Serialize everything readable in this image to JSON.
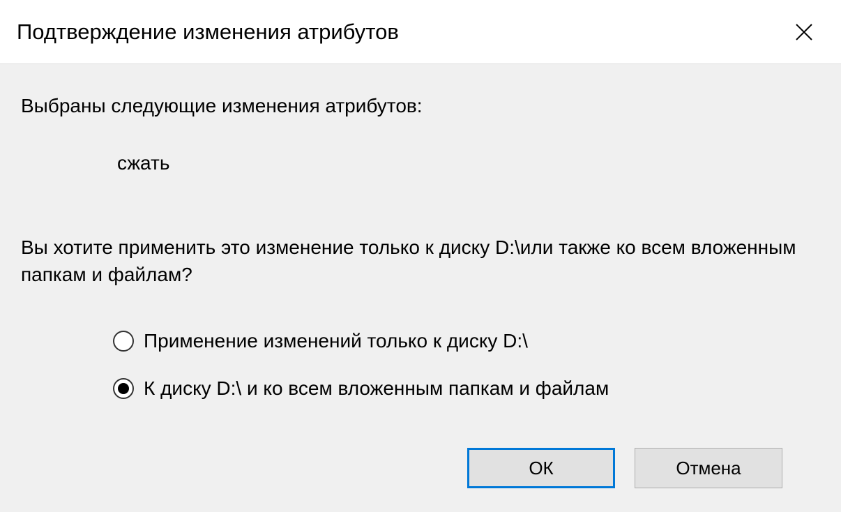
{
  "titlebar": {
    "title": "Подтверждение изменения атрибутов"
  },
  "content": {
    "intro": "Выбраны следующие изменения атрибутов:",
    "attribute": "сжать",
    "question": "Вы хотите применить это изменение только к диску D:\\или также ко всем вложенным папкам и файлам?",
    "radios": [
      {
        "label": "Применение изменений только к диску D:\\",
        "selected": false
      },
      {
        "label": "К диску D:\\ и ко всем вложенным папкам и файлам",
        "selected": true
      }
    ]
  },
  "buttons": {
    "ok": "ОК",
    "cancel": "Отмена"
  }
}
